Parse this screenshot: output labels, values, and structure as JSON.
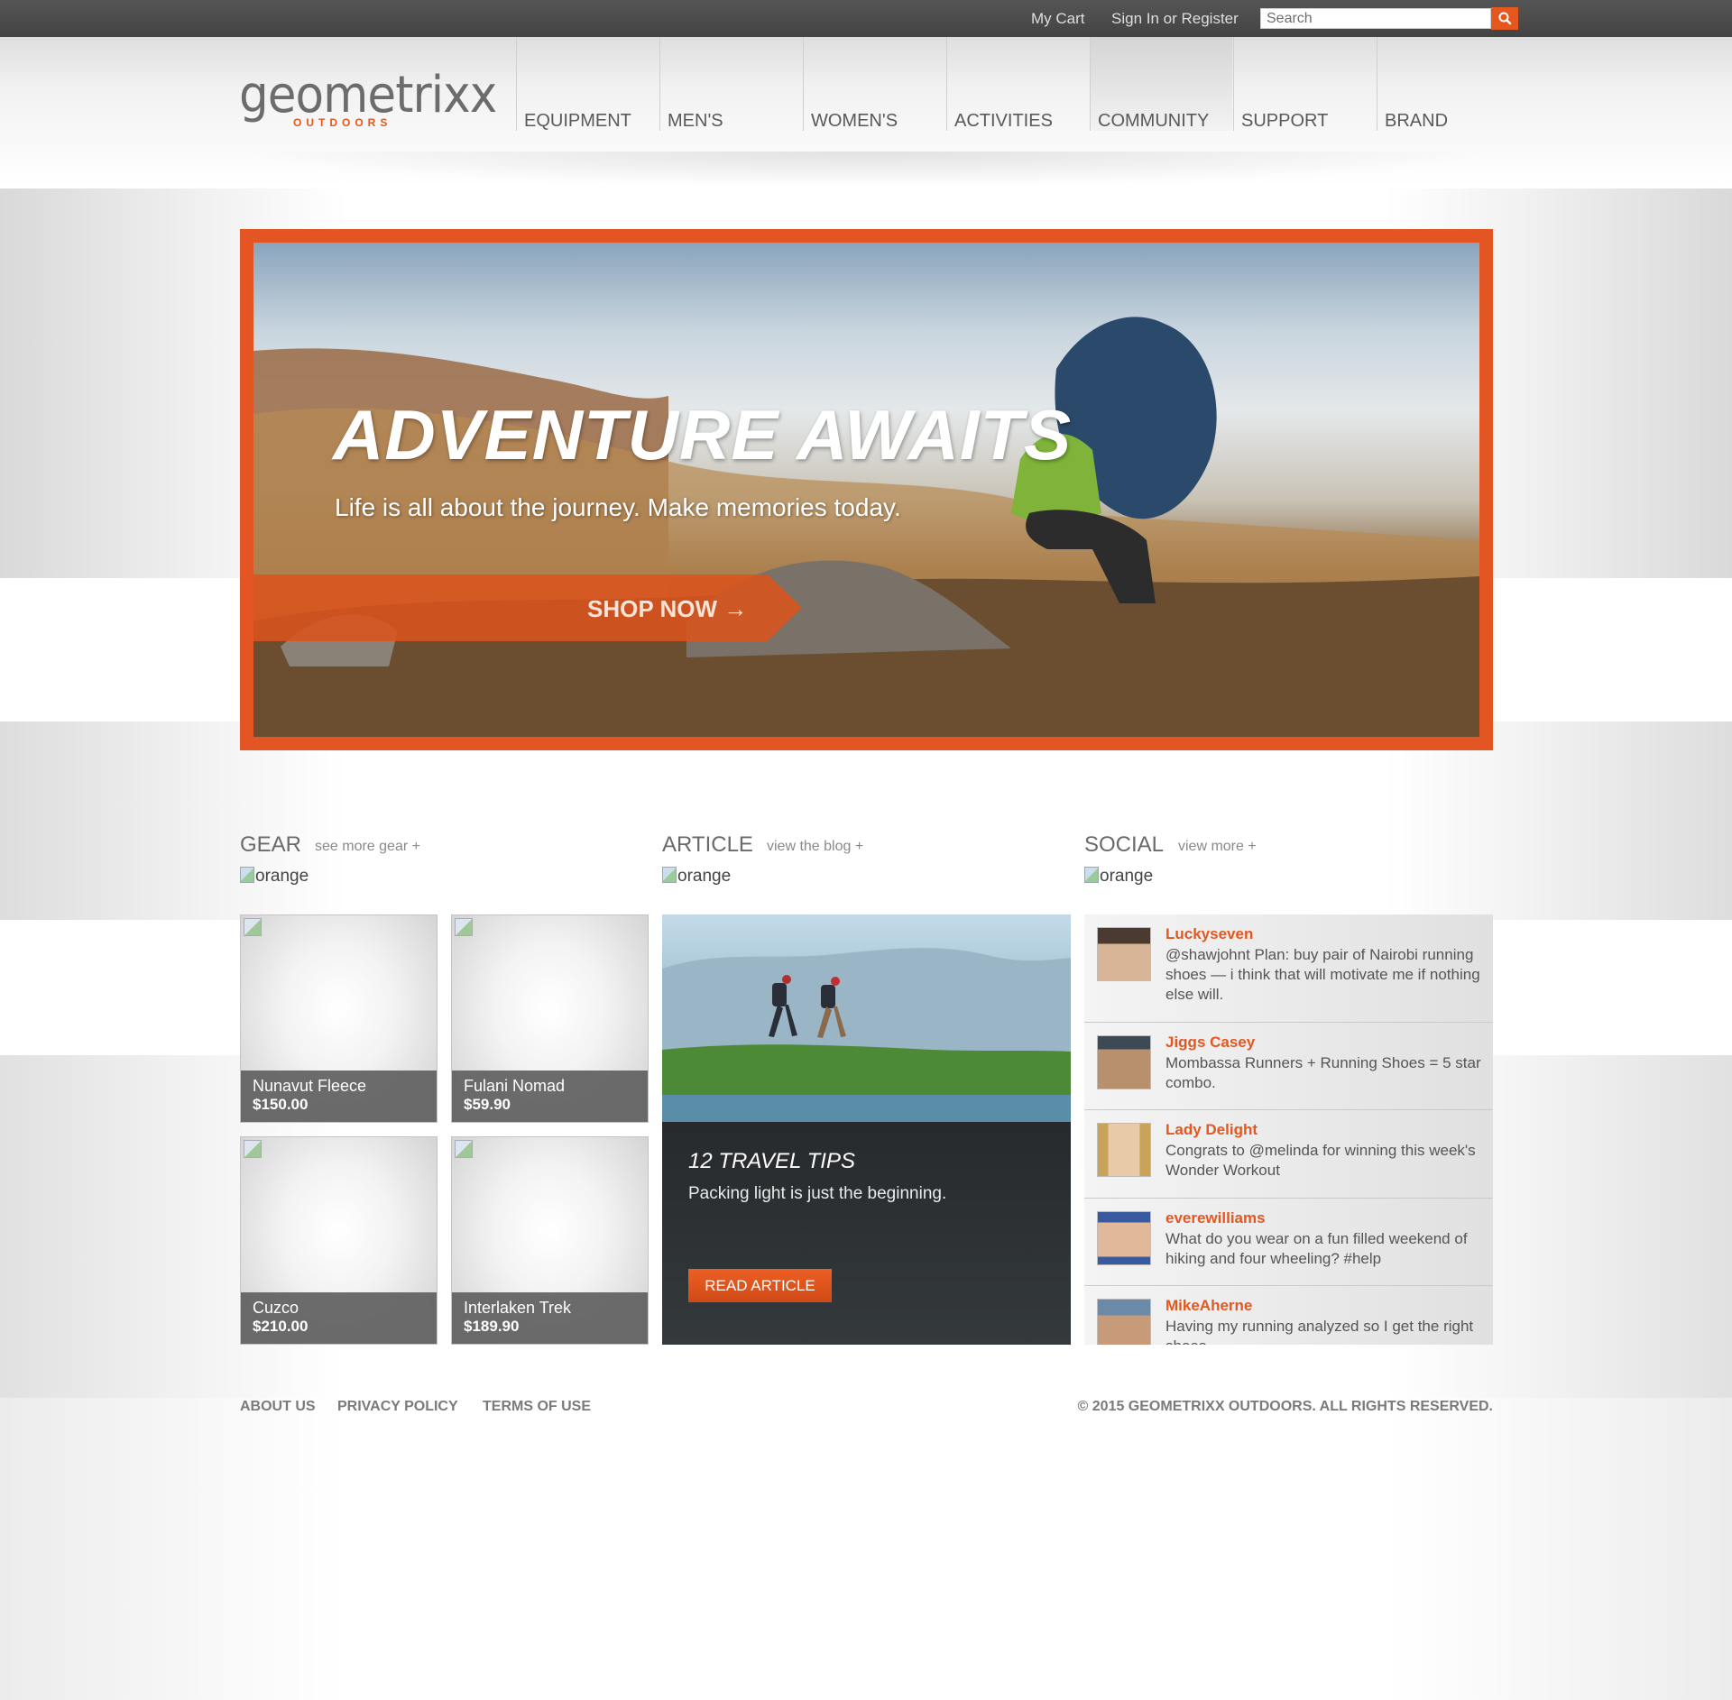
{
  "topbar": {
    "cart_label": "My Cart",
    "signin_label": "Sign In or Register",
    "search_placeholder": "Search"
  },
  "brand": {
    "logo_text": "geometrixx",
    "logo_sub": "OUTDOORS",
    "accent_color": "#e4571f"
  },
  "nav": {
    "items": [
      {
        "label": "EQUIPMENT"
      },
      {
        "label": "MEN'S"
      },
      {
        "label": "WOMEN'S"
      },
      {
        "label": "ACTIVITIES"
      },
      {
        "label": "COMMUNITY"
      },
      {
        "label": "SUPPORT"
      },
      {
        "label": "BRAND"
      }
    ]
  },
  "hero": {
    "title": "ADVENTURE AWAITS",
    "subtitle": "Life is all about the journey. Make memories today.",
    "cta": "SHOP NOW →"
  },
  "gear": {
    "title": "GEAR",
    "link": "see more gear +",
    "image_alt": "orange",
    "items": [
      {
        "name": "Nunavut Fleece",
        "price": "$150.00"
      },
      {
        "name": "Fulani Nomad",
        "price": "$59.90"
      },
      {
        "name": "Cuzco",
        "price": "$210.00"
      },
      {
        "name": "Interlaken Trek",
        "price": "$189.90"
      }
    ]
  },
  "article": {
    "title": "ARTICLE",
    "link": "view the blog +",
    "image_alt": "orange",
    "headline": "12 TRAVEL TIPS",
    "description": "Packing light is just the beginning.",
    "button": "READ ARTICLE"
  },
  "social": {
    "title": "SOCIAL",
    "link": "view more +",
    "image_alt": "orange",
    "posts": [
      {
        "user": "Luckyseven",
        "text": "@shawjohnt Plan: buy pair of Nairobi running shoes — i think that will motivate me if nothing else will."
      },
      {
        "user": "Jiggs Casey",
        "text": "Mombassa Runners + Running Shoes = 5 star combo."
      },
      {
        "user": "Lady Delight",
        "text": "Congrats to @melinda for winning this week's Wonder Workout"
      },
      {
        "user": "everewilliams",
        "text": "What do you wear on a fun filled weekend of hiking and four wheeling? #help"
      },
      {
        "user": "MikeAherne",
        "text": "Having my running analyzed so I get the right shoes"
      }
    ]
  },
  "footer": {
    "links": [
      "ABOUT US",
      "PRIVACY POLICY",
      "TERMS OF USE"
    ],
    "copyright": "© 2015 GEOMETRIXX OUTDOORS. ALL RIGHTS RESERVED."
  }
}
